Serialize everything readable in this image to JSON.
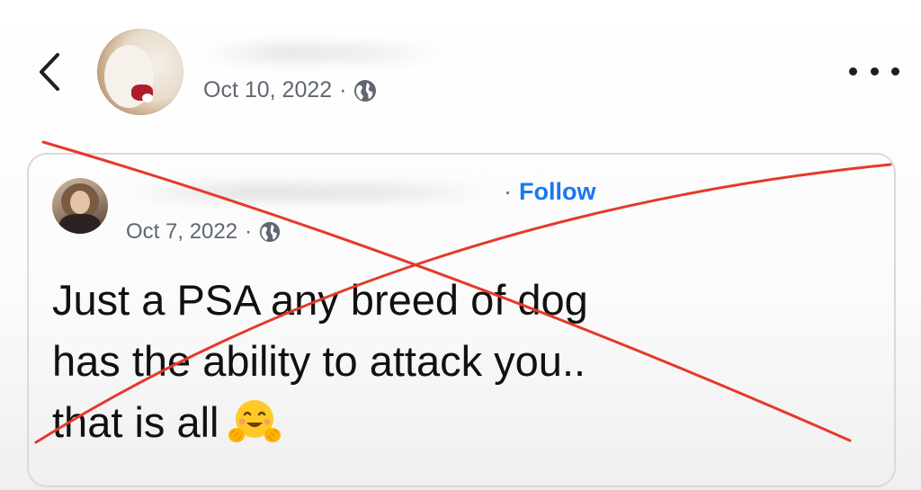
{
  "header": {
    "back_icon": "chevron-left-icon",
    "date": "Oct 10, 2022",
    "separator": "·",
    "privacy_icon": "globe-icon",
    "more_icon": "more-horizontal-icon"
  },
  "shared_post": {
    "separator": "·",
    "follow_label": "Follow",
    "date": "Oct 7, 2022",
    "privacy_icon": "globe-icon",
    "text_lines": [
      "Just a PSA any breed of dog",
      "has the ability to attack you..",
      "that is all"
    ],
    "emoji": "hugging-face-emoji"
  },
  "colors": {
    "link": "#1877f2",
    "meta": "#606770",
    "text": "#111111",
    "cross_out": "#e5392b"
  }
}
